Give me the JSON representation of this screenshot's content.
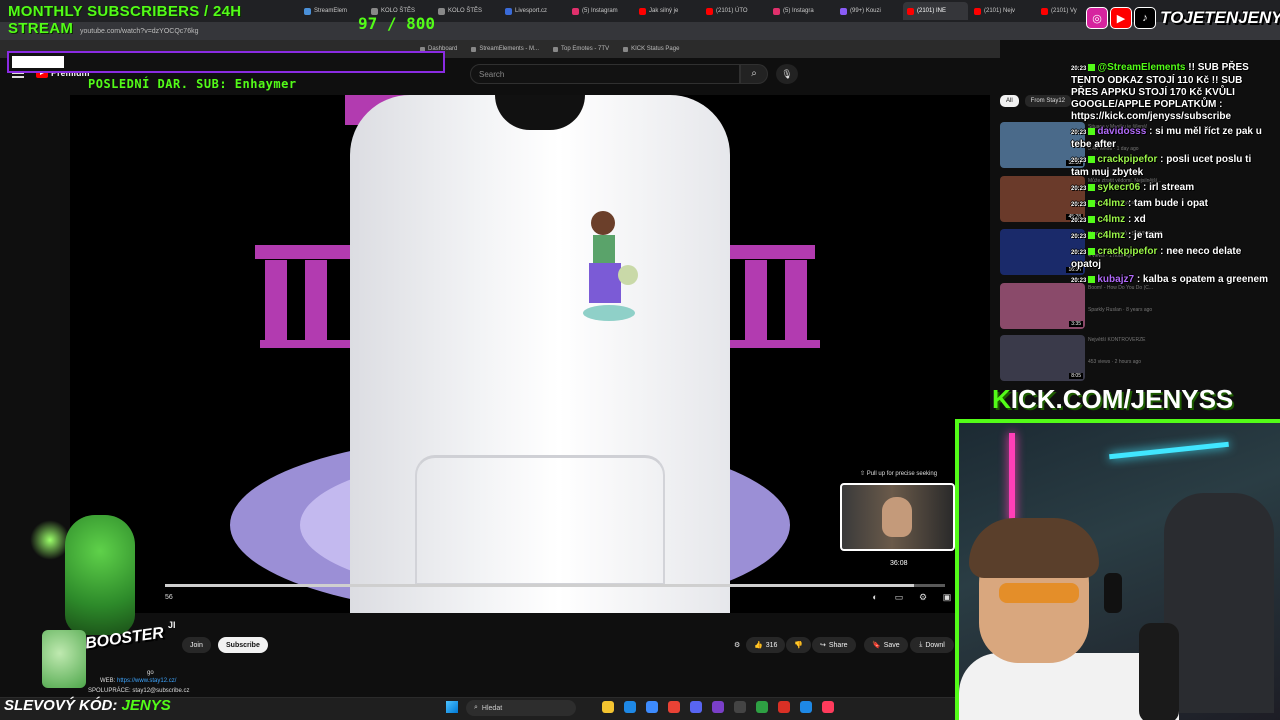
{
  "browser": {
    "tabs": [
      {
        "label": "StreamElem",
        "color": "#4a90d9"
      },
      {
        "label": "KOLO ŠTĚS",
        "color": "#888888"
      },
      {
        "label": "KOLO ŠTĚS",
        "color": "#888888"
      },
      {
        "label": "Livesport.cz",
        "color": "#3a6bd9"
      },
      {
        "label": "(5) Instagram",
        "color": "#e1306c"
      },
      {
        "label": "Jak silný je",
        "color": "#ff0000"
      },
      {
        "label": "(2101) ÚTO",
        "color": "#ff0000"
      },
      {
        "label": "(5) Instagra",
        "color": "#e1306c"
      },
      {
        "label": "(99+) Kouzi",
        "color": "#8a5cf6"
      },
      {
        "label": "(2101) INE",
        "color": "#ff0000"
      },
      {
        "label": "(2101) Nejv",
        "color": "#ff0000"
      },
      {
        "label": "(2101) Vy",
        "color": "#ff0000"
      }
    ],
    "url": "youtube.com/watch?v=dzYOCQc76kg",
    "bookmarks": [
      "Dashboard",
      "StreamElements - M...",
      "Top Emotes - 7TV",
      "KICK Status Page"
    ]
  },
  "youtube": {
    "brand": "Premium",
    "search_placeholder": "Search",
    "search_icon": "search-icon",
    "mic_icon": "mic-icon",
    "chips": [
      "All",
      "From Stay12"
    ],
    "preview_hint": "⇧ Pull up for precise seeking",
    "preview_time": "36:08",
    "timecode": "56",
    "progress_fraction": 0.96,
    "channel_initials": "JI",
    "join_label": "Join",
    "subscribe_label": "Subscribe",
    "like_count": "316",
    "share_label": "Share",
    "save_label": "Save",
    "download_label": "Downl",
    "description_line1_prefix": "WEB:",
    "description_line1_link": "https://www.stay12.cz/",
    "description_line2": "SPOLUPRÁCE: stay12@subscribe.cz",
    "upload_ago": "go"
  },
  "recommendations": [
    {
      "title": "Situace v Mexiku je šílená!",
      "meta": "5.4K views · 1 day ago",
      "duration": "32:30",
      "color": "#4a6a8a"
    },
    {
      "title": "Může ztratit vědomí. Nejsilnější...",
      "meta": "54K views · 2 days ago",
      "duration": "45:28",
      "color": "#6a3a2a"
    },
    {
      "title": "Představení týmů - SPRING CUP",
      "meta": "4 views · 1 hour ago",
      "duration": "16:34",
      "color": "#1a2a6a"
    },
    {
      "title": "Boom! - How Do You Do (C...",
      "meta": "Sparkly Ruslan · 8 years ago",
      "duration": "3:35",
      "color": "#8a4a6a"
    },
    {
      "title": "Největší KONTROVERZE",
      "meta": "453 views · 2 hours ago",
      "duration": "8:05",
      "color": "#3a3a4a"
    }
  ],
  "chat": [
    {
      "time": "20:23",
      "user": "@StreamElements",
      "text": "!! SUB PŘES TENTO ODKAZ STOJÍ 110 Kč !! SUB PŘES APPKU STOJÍ 170 Kč KVŮLI GOOGLE/APPLE POPLATKŮM : https://kick.com/jenyss/subscribe",
      "style": "lime"
    },
    {
      "time": "20:23",
      "user": "davidosss",
      "text": ": si mu měl říct ze pak u tebe after",
      "style": "purple"
    },
    {
      "time": "20:23",
      "user": "crackpipefor",
      "text": ": posli ucet poslu ti tam muj zbytek",
      "style": "green"
    },
    {
      "time": "20:23",
      "user": "sykecr06",
      "text": ": irl stream",
      "style": "green"
    },
    {
      "time": "20:23",
      "user": "c4lmz",
      "text": ": tam bude i opat",
      "style": "green"
    },
    {
      "time": "20:23",
      "user": "c4lmz",
      "text": ": xd",
      "style": "green"
    },
    {
      "time": "20:23",
      "user": "c4lmz",
      "text": ": je tam",
      "style": "green"
    },
    {
      "time": "20:23",
      "user": "crackpipefor",
      "text": ": nee neco delate opatoj",
      "style": "green"
    },
    {
      "time": "20:23",
      "user": "kubajz7",
      "text": ": kalba s opatem a greenem",
      "style": "purple"
    }
  ],
  "overlay": {
    "title_line1": "MONTHLY SUBSCRIBERS / 24H",
    "title_line2": "STREAM",
    "counter": "97 / 800",
    "counter_fraction": 0.12,
    "last_sub": "POSLEDNÍ DAR. SUB: Enhaymer",
    "social_name": "TOJETENJENYS",
    "kick_k": "K",
    "kick_url": "ICK.COM/JENYSS",
    "code_label": "SLEVOVÝ KÓD:",
    "code_value": "JENYS",
    "booster_text": "BOOSTER",
    "colors": {
      "accent": "#53fc18",
      "bar_border": "#8a2be2"
    }
  },
  "taskbar": {
    "search_label": "Hledat",
    "search_icon": "search-icon",
    "icons": [
      "file-explorer-icon",
      "edge-icon",
      "store-icon",
      "chrome-icon",
      "discord-icon",
      "obs-icon",
      "terminal-icon",
      "browser-icon",
      "chrome-dev-icon",
      "notepad-icon",
      "music-icon"
    ]
  }
}
